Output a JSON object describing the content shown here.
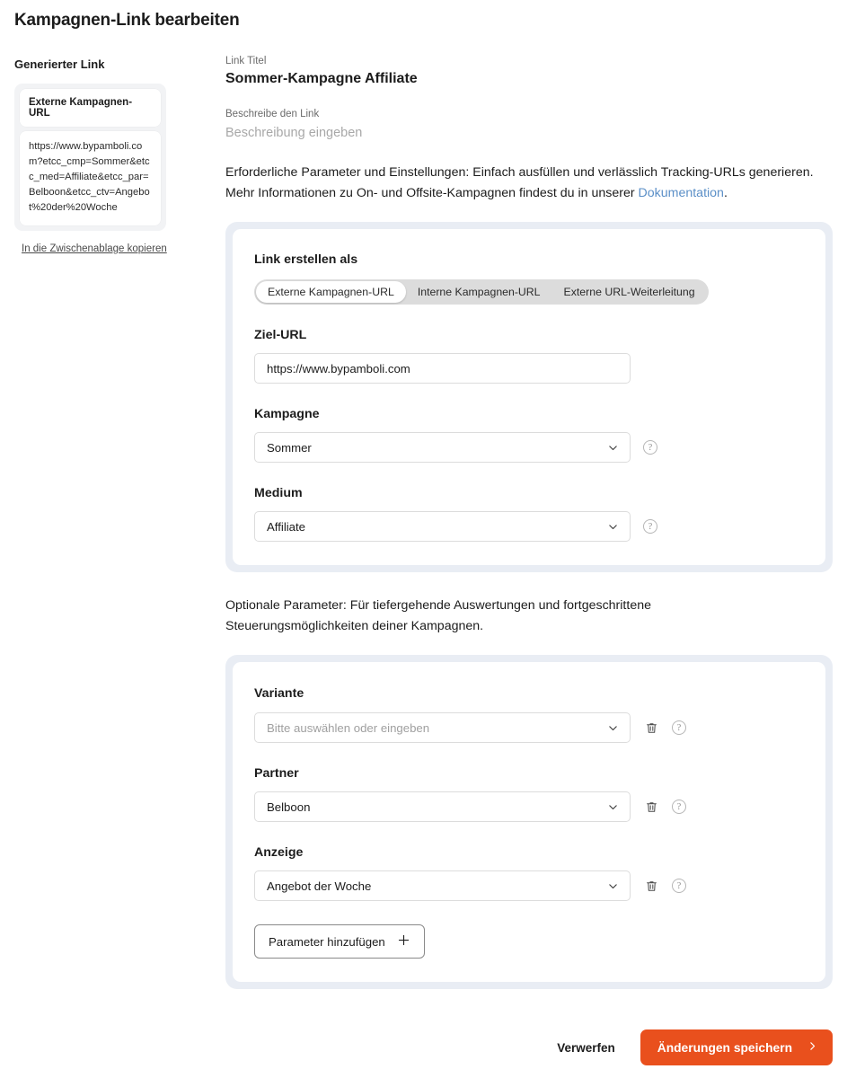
{
  "page": {
    "title": "Kampagnen-Link bearbeiten"
  },
  "sidebar": {
    "heading": "Generierter Link",
    "link_type": "Externe Kampagnen-URL",
    "generated_url": "https://www.bypamboli.com?etcc_cmp=Sommer&etcc_med=Affiliate&etcc_par=Belboon&etcc_ctv=Angebot%20der%20Woche",
    "copy_label": "In die Zwischenablage kopieren"
  },
  "header": {
    "title_label": "Link Titel",
    "title_value": "Sommer-Kampagne Affiliate",
    "description_label": "Beschreibe den Link",
    "description_placeholder": "Beschreibung eingeben",
    "intro_text_1": "Erforderliche Parameter und Einstellungen: Einfach ausfüllen und verlässlich Tracking-URLs generieren. Mehr Informationen zu On- und Offsite-Kampagnen findest du in unserer ",
    "intro_link_label": "Dokumentation",
    "intro_text_2": "."
  },
  "required_card": {
    "section_label": "Link erstellen als",
    "tabs": [
      {
        "label": "Externe Kampagnen-URL",
        "active": true
      },
      {
        "label": "Interne Kampagnen-URL",
        "active": false
      },
      {
        "label": "Externe URL-Weiterleitung",
        "active": false
      }
    ],
    "target_url": {
      "label": "Ziel-URL",
      "value": "https://www.bypamboli.com"
    },
    "campaign": {
      "label": "Kampagne",
      "value": "Sommer",
      "help_icon": "question-circle-icon",
      "chevron_icon": "chevron-down-icon"
    },
    "medium": {
      "label": "Medium",
      "value": "Affiliate",
      "help_icon": "question-circle-icon",
      "chevron_icon": "chevron-down-icon"
    }
  },
  "optional_hint": "Optionale Parameter: Für tiefergehende Auswertungen und fortgeschrittene Steuerungsmöglichkeiten deiner Kampagnen.",
  "optional_card": {
    "rows": [
      {
        "label": "Variante",
        "value": "Bitte auswählen oder eingeben",
        "is_placeholder": true,
        "delete_icon": "trash-icon",
        "help_icon": "question-circle-icon"
      },
      {
        "label": "Partner",
        "value": "Belboon",
        "is_placeholder": false,
        "delete_icon": "trash-icon",
        "help_icon": "question-circle-icon"
      },
      {
        "label": "Anzeige",
        "value": "Angebot der Woche",
        "is_placeholder": false,
        "delete_icon": "trash-icon",
        "help_icon": "question-circle-icon"
      }
    ],
    "add_param_label": "Parameter hinzufügen",
    "add_param_icon": "plus-icon"
  },
  "footer": {
    "discard_label": "Verwerfen",
    "save_label": "Änderungen speichern",
    "save_icon": "chevron-right-icon",
    "save_color": "#e9501d"
  },
  "colors": {
    "accent_orange": "#e9501d",
    "link_blue": "#5b8fc7",
    "card_frame": "#e9edf4",
    "segment_track": "#dcdcdc"
  }
}
